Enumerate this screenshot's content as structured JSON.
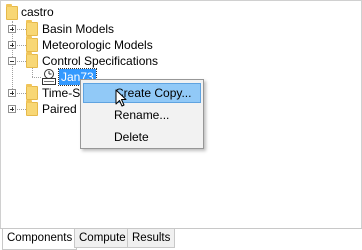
{
  "tree": {
    "root": {
      "label": "castro",
      "icon": "folder-icon"
    },
    "items": [
      {
        "label": "Basin Models",
        "expander": "plus",
        "icon": "folder-icon"
      },
      {
        "label": "Meteorologic Models",
        "expander": "plus",
        "icon": "folder-icon"
      },
      {
        "label": "Control Specifications",
        "expander": "minus",
        "icon": "folder-icon"
      },
      {
        "label": "Time-Se",
        "expander": "plus",
        "icon": "folder-icon"
      },
      {
        "label": "Paired D",
        "expander": "plus",
        "icon": "folder-icon"
      }
    ],
    "control_child": {
      "label": "Jan73",
      "icon": "control-spec-icon",
      "selected": true
    }
  },
  "context_menu": {
    "items": [
      {
        "label": "Create Copy...",
        "highlighted": true
      },
      {
        "label": "Rename..."
      },
      {
        "label": "Delete"
      }
    ]
  },
  "tabs": [
    {
      "label": "Components",
      "active": true
    },
    {
      "label": "Compute"
    },
    {
      "label": "Results"
    }
  ]
}
